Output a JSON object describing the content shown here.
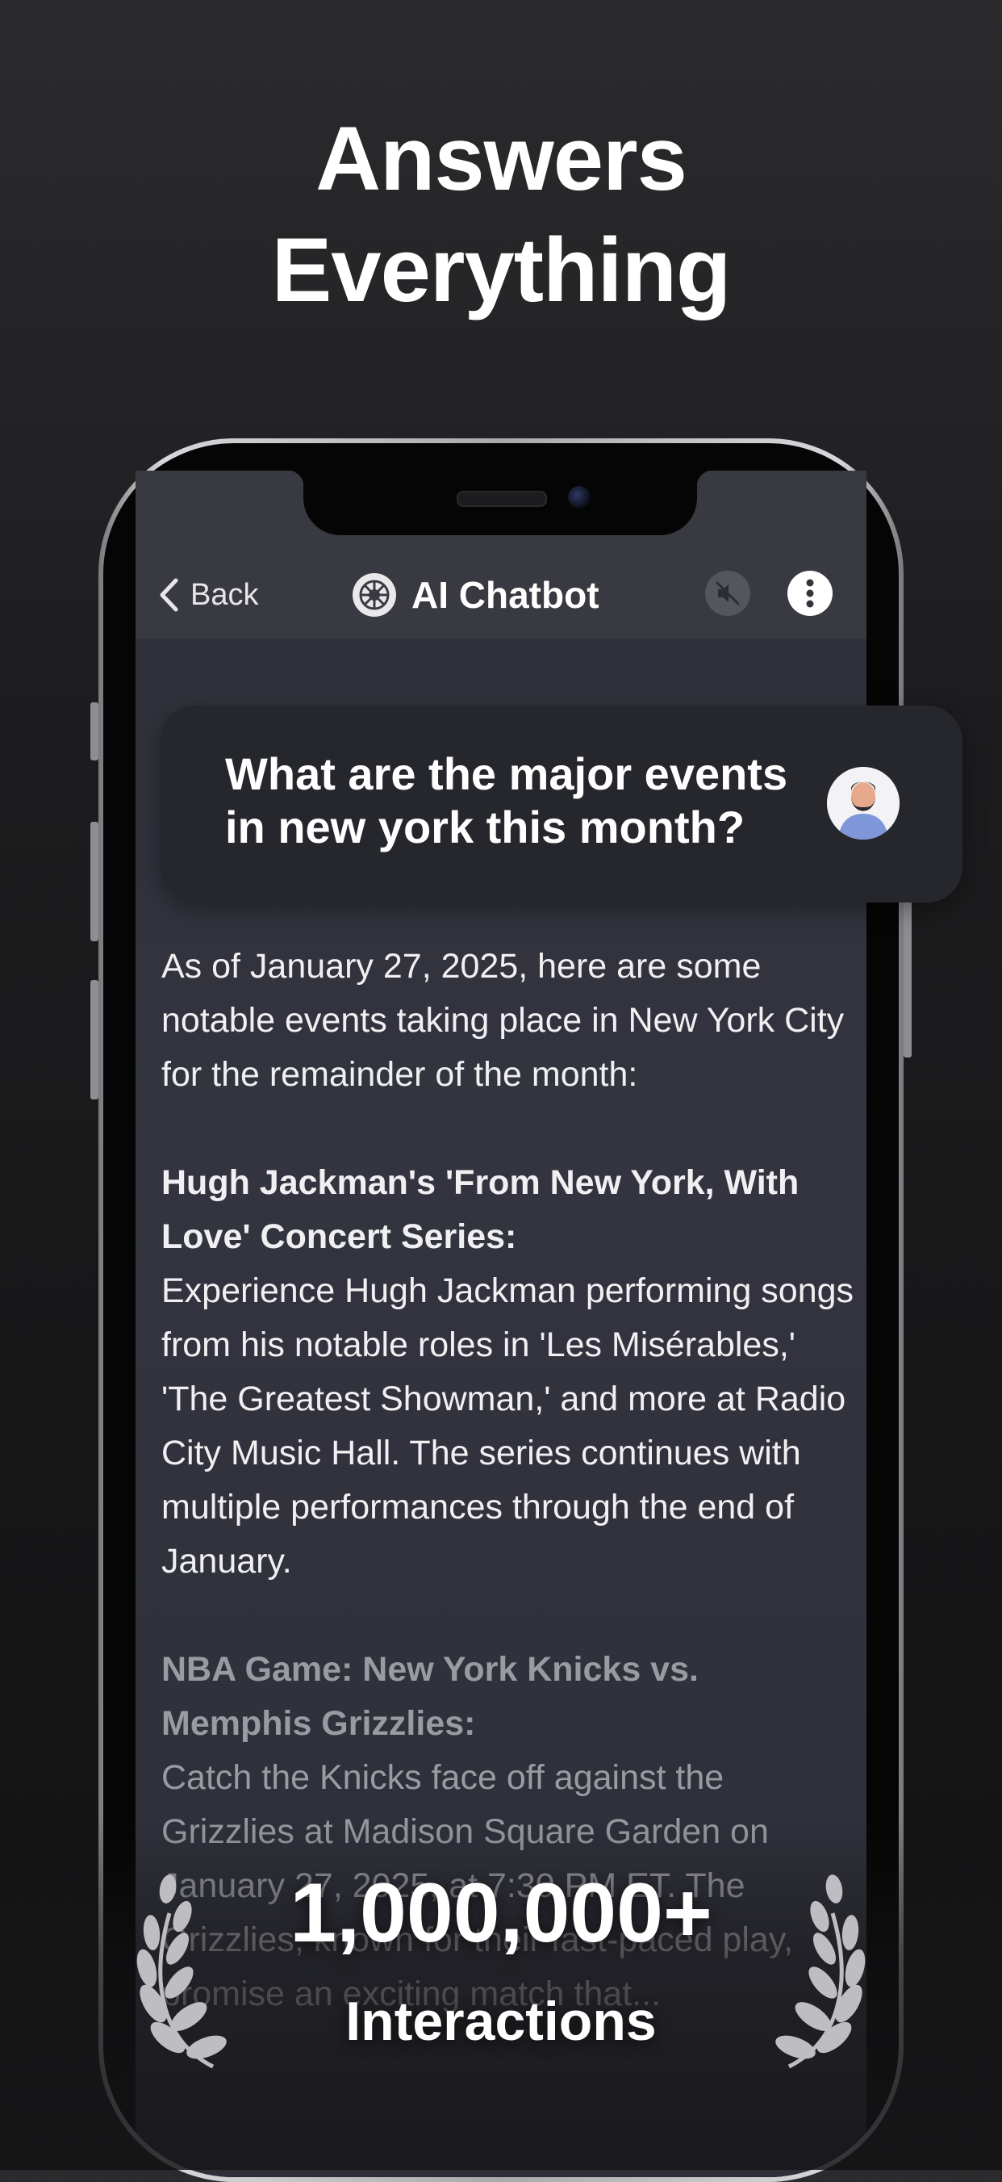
{
  "headline": {
    "line1": "Answers",
    "line2": "Everything"
  },
  "app_bar": {
    "back_label": "Back",
    "title": "AI Chatbot",
    "icons": [
      "chevron-left-icon",
      "chatbot-logo-icon",
      "speaker-muted-icon",
      "more-vertical-icon"
    ]
  },
  "chat": {
    "user_message": "What are the major events in new york this month?",
    "answer": {
      "intro": "As of January 27, 2025, here are some notable events taking place in New York City for the remainder of the month:",
      "items": [
        {
          "heading": "Hugh Jackman's 'From New York, With Love' Concert Series:",
          "body": "Experience Hugh Jackman performing songs from his notable roles in 'Les Misérables,' 'The Greatest Showman,' and more at Radio City Music Hall. The series continues with multiple performances through the end of January."
        },
        {
          "heading": "NBA Game: New York Knicks vs. Memphis Grizzlies:",
          "body": "Catch the Knicks face off against the Grizzlies at Madison Square Garden on January 27, 2025, at 7:30 PM ET. The Grizzlies, known for their fast-paced play, promise an exciting match that..."
        }
      ]
    }
  },
  "badge": {
    "value": "1,000,000+",
    "label": "Interactions",
    "icon": "laurel-wreath-icon"
  },
  "colors": {
    "background": "#1c1c1e",
    "screen": "#33343f",
    "bubble": "#26272c",
    "accent": "#ffffff"
  }
}
